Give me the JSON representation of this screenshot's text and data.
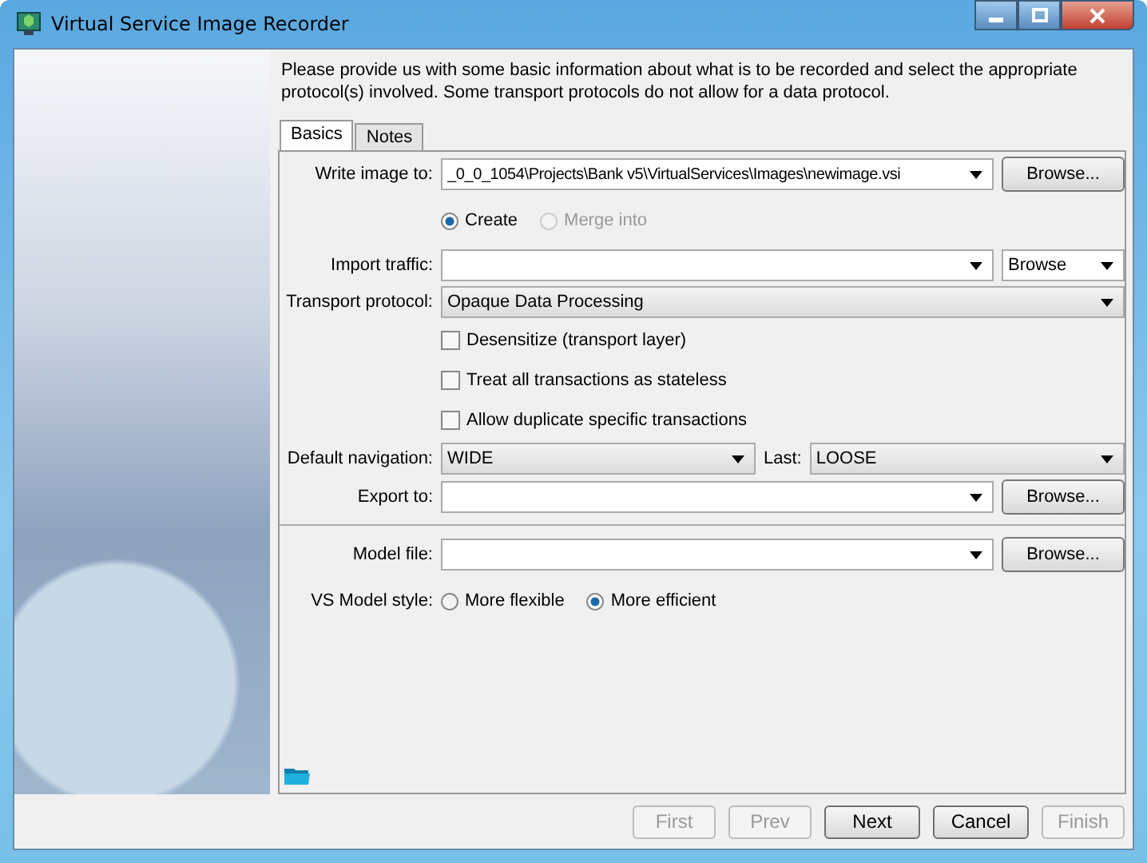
{
  "window": {
    "title": "Virtual Service Image Recorder"
  },
  "intro": "Please provide us with some basic information about what is to be recorded and select the appropriate protocol(s) involved.  Some transport protocols do not allow for a data protocol.",
  "tabs": [
    {
      "label": "Basics",
      "selected": true
    },
    {
      "label": "Notes",
      "selected": false
    }
  ],
  "write_image": {
    "label": "Write image to:",
    "value": "_0_0_1054\\Projects\\Bank v5\\VirtualServices\\Images\\newimage.vsi",
    "button": "Browse..."
  },
  "write_mode": [
    {
      "label": "Create",
      "selected": true,
      "disabled": false
    },
    {
      "label": "Merge into",
      "selected": false,
      "disabled": true
    }
  ],
  "import_traffic": {
    "label": "Import traffic:",
    "browse": "Browse"
  },
  "transport_protocol": {
    "label": "Transport protocol:",
    "value": "Opaque Data Processing"
  },
  "options": [
    {
      "label": "Desensitize (transport layer)",
      "checked": false
    },
    {
      "label": "Treat all transactions as stateless",
      "checked": false
    },
    {
      "label": "Allow duplicate specific transactions",
      "checked": false
    }
  ],
  "navigation": {
    "label": "Default navigation:",
    "value": "WIDE",
    "last_label": "Last:",
    "last_value": "LOOSE"
  },
  "export_to": {
    "label": "Export to:",
    "button": "Browse..."
  },
  "model_file": {
    "label": "Model file:",
    "button": "Browse..."
  },
  "model_style": {
    "label": "VS Model style:",
    "options": [
      {
        "label": "More flexible",
        "selected": false
      },
      {
        "label": "More efficient",
        "selected": true
      }
    ]
  },
  "footer_buttons": [
    {
      "label": "First",
      "disabled": true
    },
    {
      "label": "Prev",
      "disabled": true
    },
    {
      "label": "Next",
      "disabled": false
    },
    {
      "label": "Cancel",
      "disabled": false
    },
    {
      "label": "Finish",
      "disabled": true
    }
  ]
}
